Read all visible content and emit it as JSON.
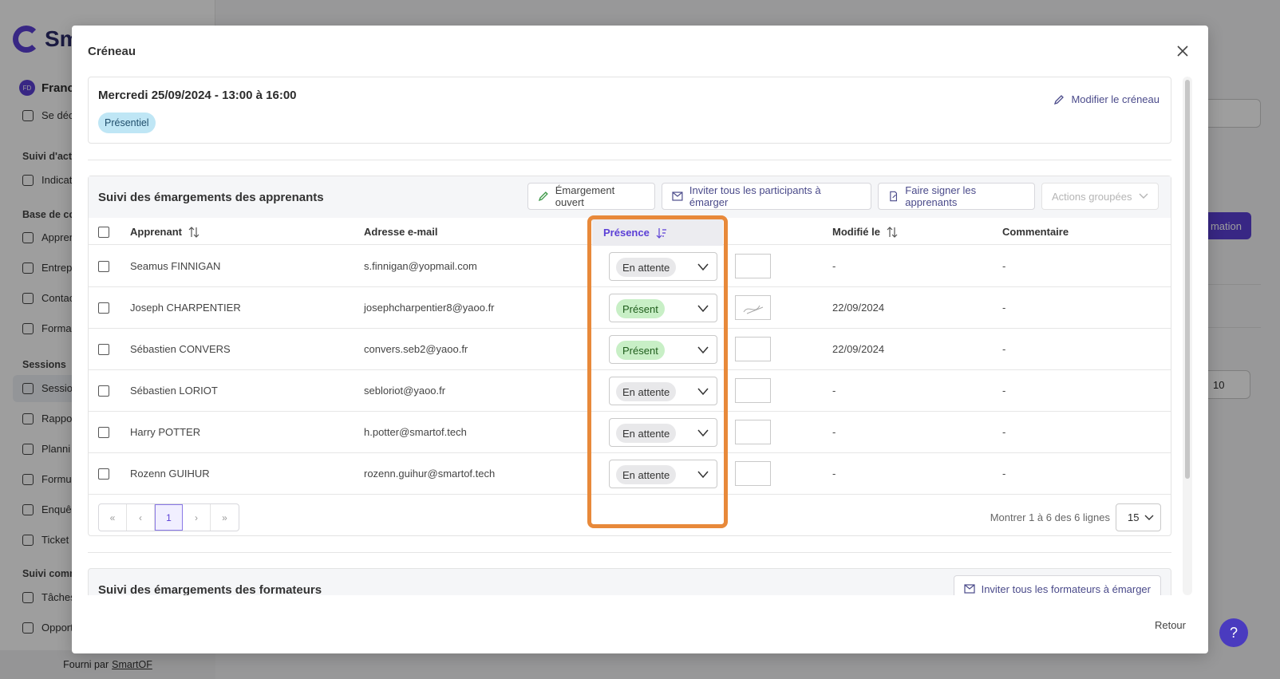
{
  "background": {
    "app_name_partial": "Sm",
    "user_initials": "FD",
    "user_name_partial": "Franc",
    "logout_partial": "Se déc",
    "sections": {
      "suivi_activite": "Suivi d'acti",
      "base_connaissance": "Base de co",
      "sessions": "Sessions",
      "suivi_commercial": "Suivi comm"
    },
    "items": {
      "indicateurs": "Indicat",
      "apprenants": "Appren",
      "entreprises": "Entrep",
      "contacts": "Contac",
      "formations": "Forma",
      "sessions": "Sessio",
      "rapports": "Rappo",
      "planning": "Planni",
      "formulaires": "Formu",
      "enquetes": "Enquê",
      "tickets": "Ticket",
      "taches": "Tâches",
      "opportunites": "Opport"
    },
    "footer_prefix": "Fourni par",
    "footer_link": "SmartOF",
    "right_button_partial": "mation",
    "right_pager_value": "10"
  },
  "modal": {
    "title": "Créneau",
    "slot": {
      "date": "Mercredi 25/09/2024 - 13:00 à 16:00",
      "mode_badge": "Présentiel",
      "edit_label": "Modifier le créneau"
    },
    "learners_section": {
      "title": "Suivi des émargements des apprenants",
      "buttons": {
        "open": "Émargement ouvert",
        "invite_all": "Inviter tous les participants à émarger",
        "sign": "Faire signer les apprenants",
        "actions": "Actions groupées"
      },
      "columns": {
        "learner": "Apprenant",
        "email": "Adresse e-mail",
        "presence": "Présence",
        "modified": "Modifié le",
        "comment": "Commentaire"
      },
      "rows": [
        {
          "name": "Seamus FINNIGAN",
          "email": "s.finnigan@yopmail.com",
          "presence": "En attente",
          "status": "wait",
          "signed": false,
          "modified": "-",
          "comment": "-"
        },
        {
          "name": "Joseph CHARPENTIER",
          "email": "josephcharpentier8@yaoo.fr",
          "presence": "Présent",
          "status": "present",
          "signed": true,
          "modified": "22/09/2024",
          "comment": "-"
        },
        {
          "name": "Sébastien CONVERS",
          "email": "convers.seb2@yaoo.fr",
          "presence": "Présent",
          "status": "present",
          "signed": false,
          "modified": "22/09/2024",
          "comment": "-"
        },
        {
          "name": "Sébastien LORIOT",
          "email": "sebloriot@yaoo.fr",
          "presence": "En attente",
          "status": "wait",
          "signed": false,
          "modified": "-",
          "comment": "-"
        },
        {
          "name": "Harry POTTER",
          "email": "h.potter@smartof.tech",
          "presence": "En attente",
          "status": "wait",
          "signed": false,
          "modified": "-",
          "comment": "-"
        },
        {
          "name": "Rozenn GUIHUR",
          "email": "rozenn.guihur@smartof.tech",
          "presence": "En attente",
          "status": "wait",
          "signed": false,
          "modified": "-",
          "comment": "-"
        }
      ],
      "pagination": {
        "current_page": "1",
        "rows_info": "Montrer 1 à 6 des 6 lignes",
        "rows_per_page": "15"
      }
    },
    "trainers_section": {
      "title": "Suivi des émargements des formateurs",
      "invite_button": "Inviter tous les formateurs à émarger"
    },
    "footer_button": "Retour"
  },
  "help_label": "?",
  "colors": {
    "accent": "#5b3fd6",
    "highlight": "#e8893a",
    "present_chip": "#c8efc6",
    "wait_chip": "#e8e8ea",
    "badge": "#bfe6f5"
  }
}
